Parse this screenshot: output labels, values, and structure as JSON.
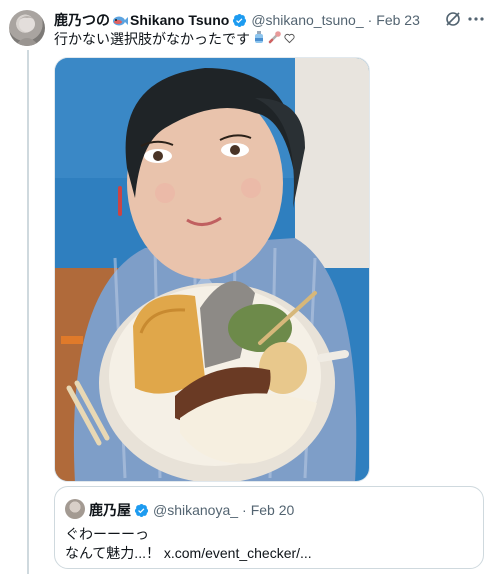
{
  "tweet": {
    "author_name": "鹿乃つの",
    "author_display_latin": "Shikano Tsuno",
    "handle": "@shikano_tsuno_",
    "separator": "·",
    "date": "Feb 23",
    "text": "行かない選択肢がなかったです"
  },
  "quote": {
    "author_name": "鹿乃屋",
    "handle": "@shikanoya_",
    "separator": "·",
    "date": "Feb 20",
    "line1": "ぐわーーーっ",
    "line2": "なんて魅力...！ x.com/event_checker/..."
  },
  "colors": {
    "verified": "#1d9bf0",
    "secondary_text": "#536471",
    "border": "#cfd9de"
  },
  "icons": [
    "grok-icon",
    "more-icon",
    "verified-badge-icon",
    "fish-emoji-icon",
    "bottle-emoji-icon",
    "blowfish-emoji-icon",
    "heart-icon"
  ]
}
